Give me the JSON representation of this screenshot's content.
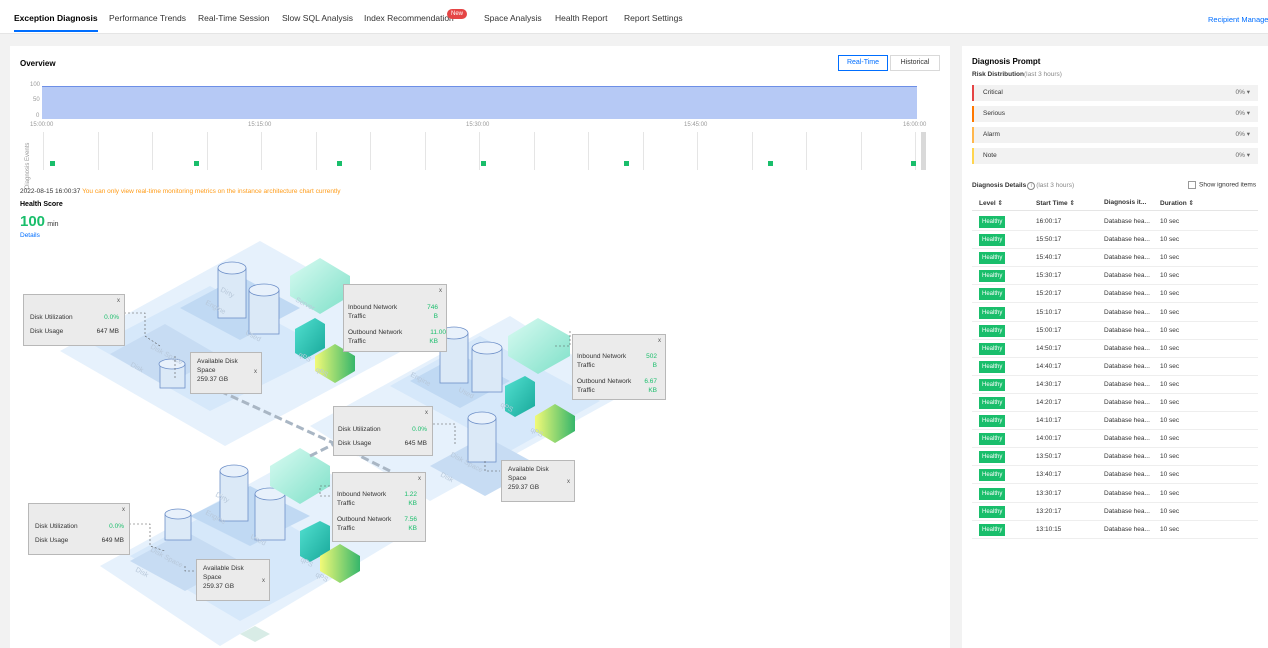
{
  "tabs": [
    {
      "label": "Exception Diagnosis",
      "active": true
    },
    {
      "label": "Performance Trends"
    },
    {
      "label": "Real-Time Session"
    },
    {
      "label": "Slow SQL Analysis"
    },
    {
      "label": "Index Recommendation",
      "badge": "New"
    },
    {
      "label": "Space Analysis"
    },
    {
      "label": "Health Report"
    },
    {
      "label": "Report Settings"
    }
  ],
  "recipient_link": "Recipient Manageme",
  "overview": {
    "title": "Overview",
    "realtime_btn": "Real-Time",
    "historical_btn": "Historical",
    "y_ticks": [
      "100",
      "50",
      "0"
    ],
    "x_ticks": [
      "15:00:00",
      "15:15:00",
      "15:30:00",
      "15:45:00",
      "16:00:00"
    ],
    "event_axis": "Diagnosis Events"
  },
  "notice": {
    "timestamp": "2022-08-15 16:00:37",
    "message": "You can only view real-time monitoring metrics on the instance architecture chart currently"
  },
  "health": {
    "label": "Health Score",
    "score": "100",
    "unit": "min",
    "details": "Details"
  },
  "popups": {
    "close": "x",
    "disk_util_label": "Disk Utilization",
    "disk_usage_label": "Disk Usage",
    "avail_label_1": "Available Disk",
    "avail_label_2": "Space",
    "in_label_1": "Inbound Network",
    "out_label_1": "Outbound Network",
    "traffic": "Traffic",
    "node1": {
      "util": "0.0%",
      "usage": "647 MB",
      "avail": "259.37 GB",
      "in1": "746",
      "in2": "B",
      "out1": "11.00",
      "out2": "KB"
    },
    "node2": {
      "util": "0.0%",
      "usage": "645 MB",
      "avail": "259.37 GB",
      "in1": "502",
      "in2": "B",
      "out1": "6.67",
      "out2": "KB"
    },
    "node3": {
      "util": "0.0%",
      "usage": "649 MB",
      "avail": "259.37 GB",
      "in1": "1.22",
      "in2": "KB",
      "out1": "7.56",
      "out2": "KB"
    }
  },
  "diagram_labels": {
    "disk": "Disk",
    "disk_space": "Disk Space",
    "engine": "Engine",
    "dirty": "Dirty",
    "used": "Used",
    "server": "Server",
    "qps": "qPS",
    "qps2": "qPS"
  },
  "sidebar": {
    "title": "Diagnosis Prompt",
    "risk_title": "Risk Distribution",
    "risk_window": "(last 3 hours)",
    "risks": [
      {
        "label": "Critical",
        "pct": "0%",
        "color": "#e54545"
      },
      {
        "label": "Serious",
        "pct": "0%",
        "color": "#ff7800"
      },
      {
        "label": "Alarm",
        "pct": "0%",
        "color": "#ffb74d"
      },
      {
        "label": "Note",
        "pct": "0%",
        "color": "#ffd54f"
      }
    ],
    "details_title": "Diagnosis Details",
    "details_window": "(last 3 hours)",
    "show_ignored": "Show ignored items",
    "columns": {
      "level": "Level",
      "start": "Start Time",
      "item": "Diagnosis it...",
      "duration": "Duration"
    },
    "rows": [
      {
        "level": "Healthy",
        "start": "16:00:17",
        "item": "Database hea...",
        "duration": "10 sec"
      },
      {
        "level": "Healthy",
        "start": "15:50:17",
        "item": "Database hea...",
        "duration": "10 sec"
      },
      {
        "level": "Healthy",
        "start": "15:40:17",
        "item": "Database hea...",
        "duration": "10 sec"
      },
      {
        "level": "Healthy",
        "start": "15:30:17",
        "item": "Database hea...",
        "duration": "10 sec"
      },
      {
        "level": "Healthy",
        "start": "15:20:17",
        "item": "Database hea...",
        "duration": "10 sec"
      },
      {
        "level": "Healthy",
        "start": "15:10:17",
        "item": "Database hea...",
        "duration": "10 sec"
      },
      {
        "level": "Healthy",
        "start": "15:00:17",
        "item": "Database hea...",
        "duration": "10 sec"
      },
      {
        "level": "Healthy",
        "start": "14:50:17",
        "item": "Database hea...",
        "duration": "10 sec"
      },
      {
        "level": "Healthy",
        "start": "14:40:17",
        "item": "Database hea...",
        "duration": "10 sec"
      },
      {
        "level": "Healthy",
        "start": "14:30:17",
        "item": "Database hea...",
        "duration": "10 sec"
      },
      {
        "level": "Healthy",
        "start": "14:20:17",
        "item": "Database hea...",
        "duration": "10 sec"
      },
      {
        "level": "Healthy",
        "start": "14:10:17",
        "item": "Database hea...",
        "duration": "10 sec"
      },
      {
        "level": "Healthy",
        "start": "14:00:17",
        "item": "Database hea...",
        "duration": "10 sec"
      },
      {
        "level": "Healthy",
        "start": "13:50:17",
        "item": "Database hea...",
        "duration": "10 sec"
      },
      {
        "level": "Healthy",
        "start": "13:40:17",
        "item": "Database hea...",
        "duration": "10 sec"
      },
      {
        "level": "Healthy",
        "start": "13:30:17",
        "item": "Database hea...",
        "duration": "10 sec"
      },
      {
        "level": "Healthy",
        "start": "13:20:17",
        "item": "Database hea...",
        "duration": "10 sec"
      },
      {
        "level": "Healthy",
        "start": "13:10:15",
        "item": "Database hea...",
        "duration": "10 sec"
      }
    ]
  }
}
